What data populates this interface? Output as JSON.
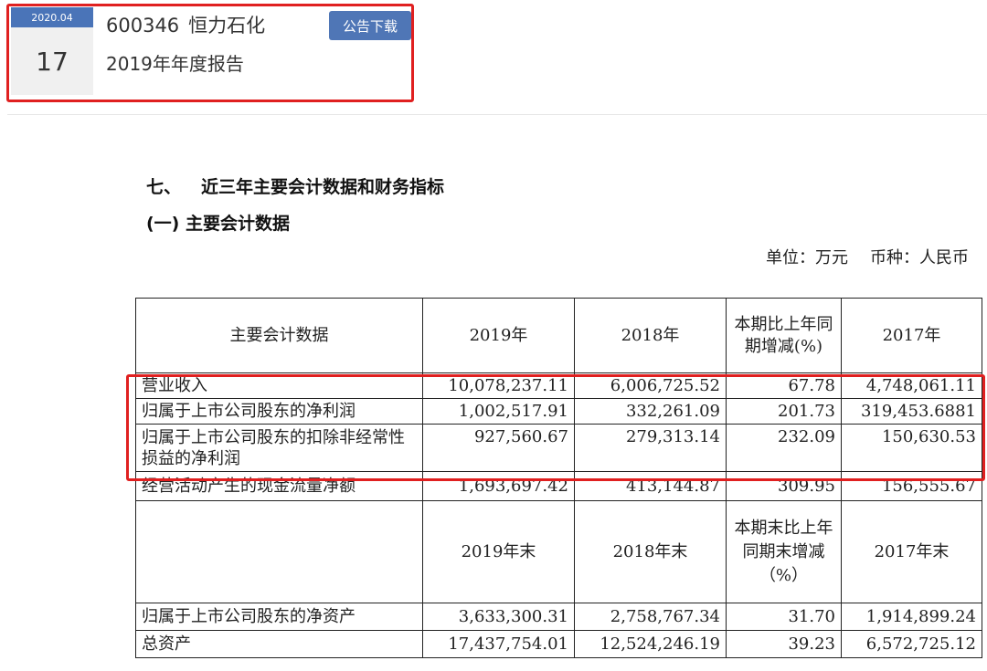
{
  "announcement": {
    "date_ym": "2020.04",
    "date_day": "17",
    "stock_code": "600346",
    "company": "恒力石化",
    "report_title": "2019年年度报告",
    "download_label": "公告下载"
  },
  "document": {
    "section_num": "七、",
    "section_title": "近三年主要会计数据和财务指标",
    "subsection": "(一) 主要会计数据",
    "unit": "单位：万元",
    "currency": "币种：人民币"
  },
  "table": {
    "header1": [
      "主要会计数据",
      "2019年",
      "2018年",
      "本期比上年同期增减(%)",
      "2017年"
    ],
    "rows1": [
      [
        "营业收入",
        "10,078,237.11",
        "6,006,725.52",
        "67.78",
        "4,748,061.11"
      ],
      [
        "归属于上市公司股东的净利润",
        "1,002,517.91",
        "332,261.09",
        "201.73",
        "319,453.6881"
      ],
      [
        "归属于上市公司股东的扣除非经常性损益的净利润",
        "927,560.67",
        "279,313.14",
        "232.09",
        "150,630.53"
      ],
      [
        "经营活动产生的现金流量净额",
        "1,693,697.42",
        "413,144.87",
        "309.95",
        "156,555.67"
      ]
    ],
    "header2": [
      "",
      "2019年末",
      "2018年末",
      "本期末比上年同期末增减（%）",
      "2017年末"
    ],
    "rows2": [
      [
        "归属于上市公司股东的净资产",
        "3,633,300.31",
        "2,758,767.34",
        "31.70",
        "1,914,899.24"
      ],
      [
        "总资产",
        "17,437,754.01",
        "12,524,246.19",
        "39.23",
        "6,572,725.12"
      ]
    ]
  },
  "colors": {
    "accent": "#4f76b6",
    "highlight": "#e02020"
  }
}
